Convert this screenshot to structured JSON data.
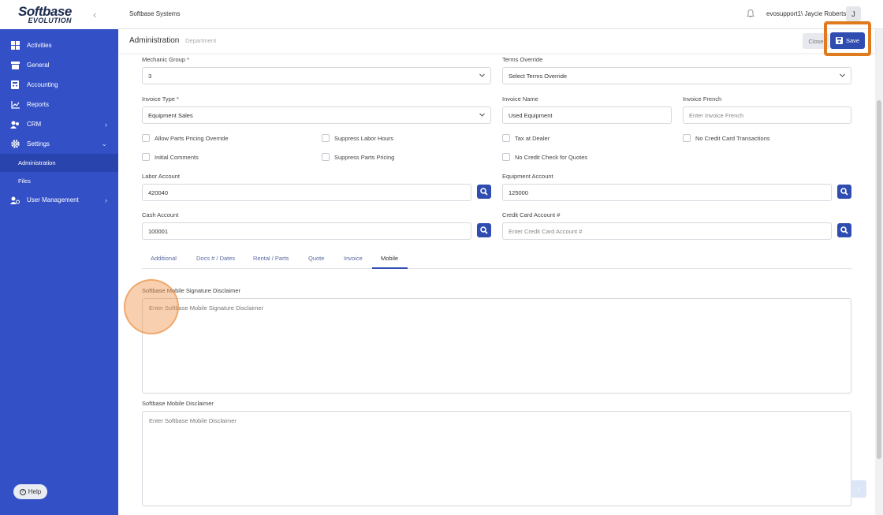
{
  "brand": {
    "line1": "Softbase",
    "line2": "EVOLUTION"
  },
  "sidebar": {
    "items": [
      {
        "label": "Activities",
        "icon": "grid-icon"
      },
      {
        "label": "General",
        "icon": "box-icon"
      },
      {
        "label": "Accounting",
        "icon": "calculator-icon"
      },
      {
        "label": "Reports",
        "icon": "chart-icon"
      },
      {
        "label": "CRM",
        "icon": "users-icon"
      },
      {
        "label": "Settings",
        "icon": "gear-icon"
      },
      {
        "label": "User Management",
        "icon": "user-cog-icon"
      }
    ],
    "subitems": [
      {
        "label": "Administration"
      },
      {
        "label": "Files"
      }
    ],
    "help": "Help"
  },
  "topbar": {
    "company": "Softbase Systems",
    "user": "evosupport1\\ Jaycie Roberts",
    "avatar": "J"
  },
  "header": {
    "title": "Administration",
    "subtitle": "Department",
    "close_label": "Close",
    "save_label": "Save"
  },
  "form": {
    "mechanic_group": {
      "label": "Mechanic Group *",
      "value": "3"
    },
    "terms_override": {
      "label": "Terms Override",
      "value": "Select Terms Override"
    },
    "invoice_type": {
      "label": "Invoice Type *",
      "value": "Equipment Sales"
    },
    "invoice_name": {
      "label": "Invoice Name",
      "value": "Used Equipment"
    },
    "invoice_french": {
      "label": "Invoice French",
      "placeholder": "Enter Invoice French"
    },
    "checkboxes": {
      "allow_parts_pricing_override": "Allow Parts Pricing Override",
      "suppress_labor_hours": "Suppress Labor Hours",
      "tax_at_dealer": "Tax at Dealer",
      "no_credit_card_transactions": "No Credit Card Transactions",
      "initial_comments": "Initial Comments",
      "suppress_parts_pricing": "Suppress Parts Pricing",
      "no_credit_check_for_quotes": "No Credit Check for Quotes"
    },
    "labor_account": {
      "label": "Labor Account",
      "value": "420040"
    },
    "equipment_account": {
      "label": "Equipment Account",
      "value": "125000"
    },
    "cash_account": {
      "label": "Cash Account",
      "value": "100001"
    },
    "credit_card_account": {
      "label": "Credit Card Account #",
      "placeholder": "Enter Credit Card Account #"
    }
  },
  "tabs": [
    {
      "label": "Additional"
    },
    {
      "label": "Docs # / Dates"
    },
    {
      "label": "Rental / Parts"
    },
    {
      "label": "Quote"
    },
    {
      "label": "Invoice"
    },
    {
      "label": "Mobile"
    }
  ],
  "mobile": {
    "signature_disclaimer": {
      "label": "Softbase Mobile Signature Disclaimer",
      "placeholder": "Enter Softbase Mobile Signature Disclaimer"
    },
    "disclaimer": {
      "label": "Softbase Mobile Disclaimer",
      "placeholder": "Enter Softbase Mobile Disclaimer"
    }
  },
  "colors": {
    "sidebar": "#3350c7",
    "primary": "#2f4cb0",
    "highlight": "#e07a1f"
  }
}
